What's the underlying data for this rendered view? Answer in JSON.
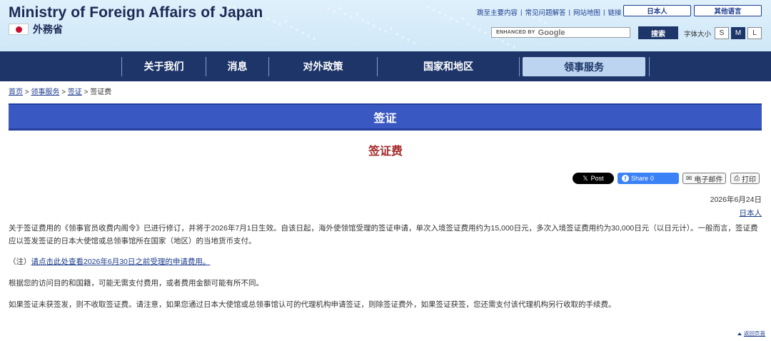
{
  "header": {
    "logo_en": "Ministry of Foreign Affairs of Japan",
    "logo_jp": "外務省",
    "utility_links": [
      "跳至主要内容",
      "常见问题解答",
      "网站地图",
      "链接"
    ],
    "lang_japanese": "日本人",
    "lang_other": "其他语言",
    "search_prefix": "ENHANCED BY",
    "search_brand": "Google",
    "search_button": "搜索",
    "fontsize_label": "字体大小",
    "fontsize_options": [
      "S",
      "M",
      "L"
    ],
    "fontsize_active": "M"
  },
  "nav": {
    "items": [
      "关于我们",
      "消息",
      "对外政策",
      "国家和地区",
      "领事服务"
    ],
    "active": "领事服务"
  },
  "breadcrumb": {
    "home": "首页",
    "sep": " > ",
    "consular": "领事服务",
    "visa": "签证",
    "current": "签证费"
  },
  "page": {
    "title": "签证",
    "subtitle": "签证费"
  },
  "share": {
    "tweet": "Post",
    "fb_label": "Share",
    "fb_count": "0",
    "email": "电子邮件",
    "print": "打印"
  },
  "meta": {
    "date": "2026年6月24日",
    "lang_link": "日本人"
  },
  "content": {
    "p1": "关于签证费用的《领事官员收费内阁令》已进行修订，并将于2026年7月1日生效。自该日起，海外使领馆受理的签证申请，单次入境签证费用约为15,000日元，多次入境签证费用约为30,000日元（以日元计）。一般而言，签证费应以签发签证的日本大使馆或总领事馆所在国家（地区）的当地货币支付。",
    "note_prefix": "（注）",
    "note_link": "请点击此处查看2026年6月30日之前受理的申请费用。",
    "p2": "根据您的访问目的和国籍，可能无需支付费用，或者费用金额可能有所不同。",
    "p3": "如果签证未获签发，则不收取签证费。请注意，如果您通过日本大使馆或总领事馆认可的代理机构申请签证，则除签证费外，如果签证获签，您还需支付该代理机构另行收取的手续费。"
  },
  "footer": {
    "back_to_top": "返回页首"
  }
}
